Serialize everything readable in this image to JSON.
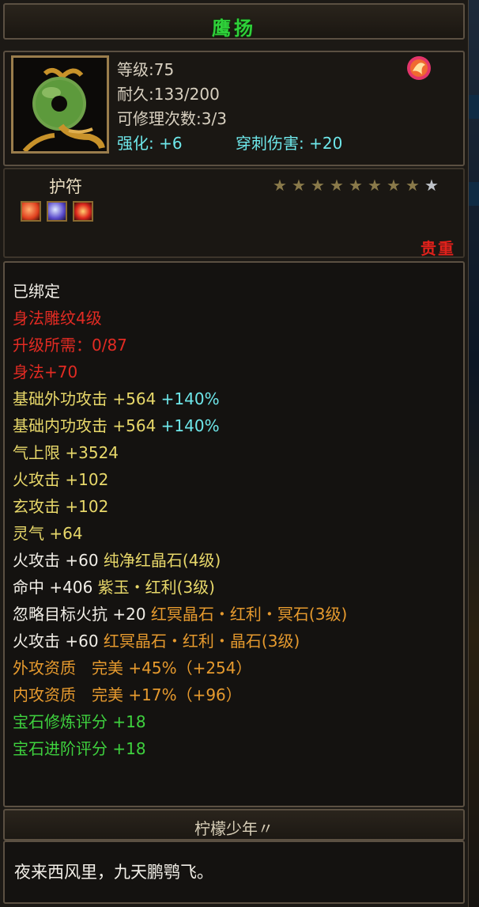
{
  "title": "鹰扬",
  "stats": {
    "level": "等级:75",
    "durability": "耐久:133/200",
    "repairs": "可修理次数:3/3",
    "enhance": "强化: +6",
    "pierce": "穿刺伤害: +20"
  },
  "item_type": "护符",
  "stars": {
    "filled": 8,
    "total": 9
  },
  "rarity": "贵重",
  "attributes": [
    {
      "segments": [
        {
          "text": "已绑定",
          "color": "white"
        }
      ]
    },
    {
      "segments": [
        {
          "text": "身法雕纹4级",
          "color": "red"
        }
      ]
    },
    {
      "segments": [
        {
          "text": "升级所需：0/87",
          "color": "red"
        }
      ]
    },
    {
      "segments": [
        {
          "text": "身法+70",
          "color": "red"
        }
      ]
    },
    {
      "segments": [
        {
          "text": "基础外功攻击 +564 ",
          "color": "yellow"
        },
        {
          "text": "+140%",
          "color": "cyan"
        }
      ]
    },
    {
      "segments": [
        {
          "text": "基础内功攻击 +564 ",
          "color": "yellow"
        },
        {
          "text": "+140%",
          "color": "cyan"
        }
      ]
    },
    {
      "segments": [
        {
          "text": "气上限 +3524",
          "color": "yellow"
        }
      ]
    },
    {
      "segments": [
        {
          "text": "火攻击 +102",
          "color": "yellow"
        }
      ]
    },
    {
      "segments": [
        {
          "text": "玄攻击 +102",
          "color": "yellow"
        }
      ]
    },
    {
      "segments": [
        {
          "text": "灵气 +64",
          "color": "yellow"
        }
      ]
    },
    {
      "segments": [
        {
          "text": "火攻击 +60 ",
          "color": "white"
        },
        {
          "text": "纯净红晶石(4级)",
          "color": "yellow"
        }
      ]
    },
    {
      "segments": [
        {
          "text": "命中 +406 ",
          "color": "white"
        },
        {
          "text": "紫玉・红利(3级)",
          "color": "yellow"
        }
      ]
    },
    {
      "segments": [
        {
          "text": "忽略目标火抗 +20 ",
          "color": "white"
        },
        {
          "text": "红冥晶石・红利・冥石(3级)",
          "color": "orange"
        }
      ]
    },
    {
      "segments": [
        {
          "text": "火攻击 +60 ",
          "color": "white"
        },
        {
          "text": "红冥晶石・红利・晶石(3级)",
          "color": "orange"
        }
      ]
    },
    {
      "segments": [
        {
          "text": "外攻资质　完美 +45%（+254）",
          "color": "orange"
        }
      ]
    },
    {
      "segments": [
        {
          "text": "内攻资质　完美 +17%（+96）",
          "color": "orange"
        }
      ]
    },
    {
      "segments": [
        {
          "text": "宝石修炼评分 +18",
          "color": "green"
        }
      ]
    },
    {
      "segments": [
        {
          "text": "宝石进阶评分 +18",
          "color": "green"
        }
      ]
    }
  ],
  "author": "柠檬少年〃",
  "quote": "夜来西风里，九天鹏鹗飞。",
  "icons": {
    "item": "jade-pendant-icon",
    "badge": "flame-emblem-icon",
    "gems": [
      "red-gem-icon",
      "purple-gem-icon",
      "red-swirl-gem-icon"
    ]
  },
  "colors": {
    "white": "#f2efe8",
    "red": "#e22b23",
    "yellow": "#e8d86a",
    "cyan": "#6ee7ea",
    "orange": "#e69a2e",
    "green": "#3ed13e"
  }
}
